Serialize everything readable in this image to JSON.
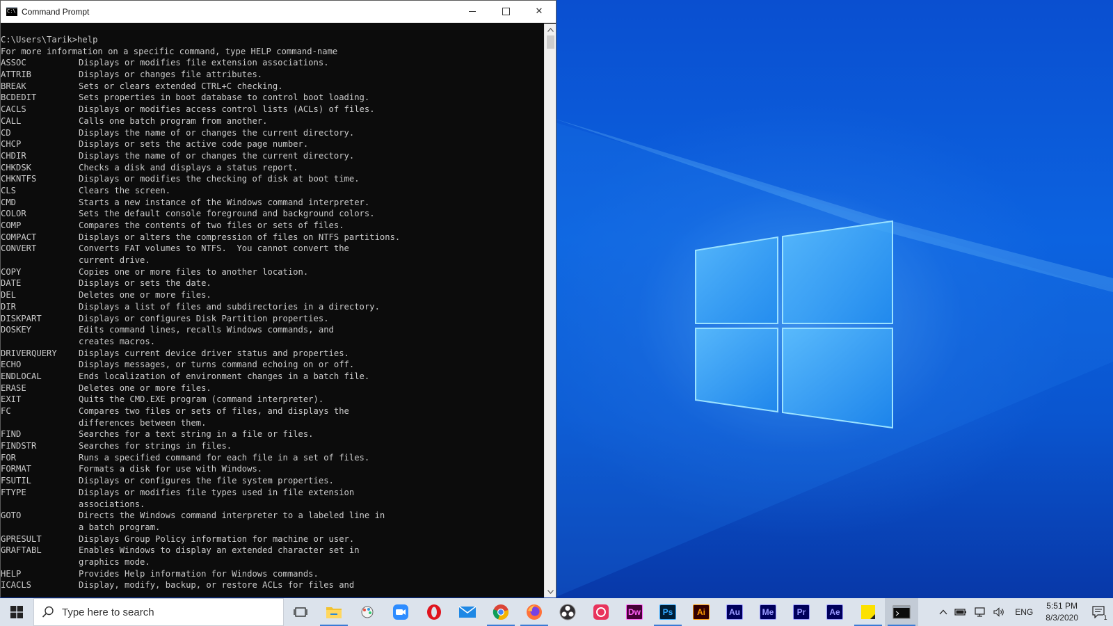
{
  "window": {
    "title": "Command Prompt",
    "close_glyph": "✕",
    "icon_text": "C:\\"
  },
  "console": {
    "prompt_line": "C:\\Users\\Tarik>help",
    "intro_line": "For more information on a specific command, type HELP command-name",
    "commands": [
      {
        "name": "ASSOC",
        "desc": "Displays or modifies file extension associations."
      },
      {
        "name": "ATTRIB",
        "desc": "Displays or changes file attributes."
      },
      {
        "name": "BREAK",
        "desc": "Sets or clears extended CTRL+C checking."
      },
      {
        "name": "BCDEDIT",
        "desc": "Sets properties in boot database to control boot loading."
      },
      {
        "name": "CACLS",
        "desc": "Displays or modifies access control lists (ACLs) of files."
      },
      {
        "name": "CALL",
        "desc": "Calls one batch program from another."
      },
      {
        "name": "CD",
        "desc": "Displays the name of or changes the current directory."
      },
      {
        "name": "CHCP",
        "desc": "Displays or sets the active code page number."
      },
      {
        "name": "CHDIR",
        "desc": "Displays the name of or changes the current directory."
      },
      {
        "name": "CHKDSK",
        "desc": "Checks a disk and displays a status report."
      },
      {
        "name": "CHKNTFS",
        "desc": "Displays or modifies the checking of disk at boot time."
      },
      {
        "name": "CLS",
        "desc": "Clears the screen."
      },
      {
        "name": "CMD",
        "desc": "Starts a new instance of the Windows command interpreter."
      },
      {
        "name": "COLOR",
        "desc": "Sets the default console foreground and background colors."
      },
      {
        "name": "COMP",
        "desc": "Compares the contents of two files or sets of files."
      },
      {
        "name": "COMPACT",
        "desc": "Displays or alters the compression of files on NTFS partitions."
      },
      {
        "name": "CONVERT",
        "desc": "Converts FAT volumes to NTFS.  You cannot convert the"
      },
      {
        "name": "",
        "desc": "current drive."
      },
      {
        "name": "COPY",
        "desc": "Copies one or more files to another location."
      },
      {
        "name": "DATE",
        "desc": "Displays or sets the date."
      },
      {
        "name": "DEL",
        "desc": "Deletes one or more files."
      },
      {
        "name": "DIR",
        "desc": "Displays a list of files and subdirectories in a directory."
      },
      {
        "name": "DISKPART",
        "desc": "Displays or configures Disk Partition properties."
      },
      {
        "name": "DOSKEY",
        "desc": "Edits command lines, recalls Windows commands, and"
      },
      {
        "name": "",
        "desc": "creates macros."
      },
      {
        "name": "DRIVERQUERY",
        "desc": "Displays current device driver status and properties."
      },
      {
        "name": "ECHO",
        "desc": "Displays messages, or turns command echoing on or off."
      },
      {
        "name": "ENDLOCAL",
        "desc": "Ends localization of environment changes in a batch file."
      },
      {
        "name": "ERASE",
        "desc": "Deletes one or more files."
      },
      {
        "name": "EXIT",
        "desc": "Quits the CMD.EXE program (command interpreter)."
      },
      {
        "name": "FC",
        "desc": "Compares two files or sets of files, and displays the"
      },
      {
        "name": "",
        "desc": "differences between them."
      },
      {
        "name": "FIND",
        "desc": "Searches for a text string in a file or files."
      },
      {
        "name": "FINDSTR",
        "desc": "Searches for strings in files."
      },
      {
        "name": "FOR",
        "desc": "Runs a specified command for each file in a set of files."
      },
      {
        "name": "FORMAT",
        "desc": "Formats a disk for use with Windows."
      },
      {
        "name": "FSUTIL",
        "desc": "Displays or configures the file system properties."
      },
      {
        "name": "FTYPE",
        "desc": "Displays or modifies file types used in file extension"
      },
      {
        "name": "",
        "desc": "associations."
      },
      {
        "name": "GOTO",
        "desc": "Directs the Windows command interpreter to a labeled line in"
      },
      {
        "name": "",
        "desc": "a batch program."
      },
      {
        "name": "GPRESULT",
        "desc": "Displays Group Policy information for machine or user."
      },
      {
        "name": "GRAFTABL",
        "desc": "Enables Windows to display an extended character set in"
      },
      {
        "name": "",
        "desc": "graphics mode."
      },
      {
        "name": "HELP",
        "desc": "Provides Help information for Windows commands."
      },
      {
        "name": "ICACLS",
        "desc": "Display, modify, backup, or restore ACLs for files and"
      }
    ]
  },
  "taskbar": {
    "search_placeholder": "Type here to search",
    "apps": [
      {
        "id": "task-view",
        "icon": "task-view-icon",
        "label": ""
      },
      {
        "id": "file-explorer",
        "icon": "folder-icon",
        "label": "",
        "color": "#f2c230"
      },
      {
        "id": "paint-3d",
        "icon": "paint-icon",
        "label": ""
      },
      {
        "id": "zoom",
        "icon": "video-camera-icon",
        "label": "",
        "color": "#2d8cff"
      },
      {
        "id": "opera",
        "icon": "opera-icon",
        "label": "",
        "color": "#e0141e"
      },
      {
        "id": "mail",
        "icon": "mail-icon",
        "label": "",
        "color": "#1e88e5"
      },
      {
        "id": "chrome",
        "icon": "chrome-icon",
        "label": ""
      },
      {
        "id": "firefox",
        "icon": "firefox-icon",
        "label": "",
        "color": "#ff7139"
      },
      {
        "id": "obs",
        "icon": "obs-icon",
        "label": ""
      },
      {
        "id": "creative-cloud",
        "icon": "creative-cloud-icon",
        "label": "",
        "color": "#e8335c"
      },
      {
        "id": "dreamweaver",
        "icon": "dreamweaver-icon",
        "label": "Dw",
        "bg": "#470137",
        "fg": "#ff61f6"
      },
      {
        "id": "photoshop",
        "icon": "photoshop-icon",
        "label": "Ps",
        "bg": "#001e36",
        "fg": "#31a8ff"
      },
      {
        "id": "illustrator",
        "icon": "illustrator-icon",
        "label": "Ai",
        "bg": "#330000",
        "fg": "#ff9a00"
      },
      {
        "id": "audition",
        "icon": "audition-icon",
        "label": "Au",
        "bg": "#00005b",
        "fg": "#9999ff"
      },
      {
        "id": "media-encoder",
        "icon": "media-encoder-icon",
        "label": "Me",
        "bg": "#00005b",
        "fg": "#9999ff"
      },
      {
        "id": "premiere",
        "icon": "premiere-icon",
        "label": "Pr",
        "bg": "#00005b",
        "fg": "#9999ff"
      },
      {
        "id": "after-effects",
        "icon": "after-effects-icon",
        "label": "Ae",
        "bg": "#00005b",
        "fg": "#9999ff"
      },
      {
        "id": "sticky-notes",
        "icon": "sticky-notes-icon",
        "label": "",
        "color": "#fce100"
      },
      {
        "id": "command-prompt",
        "icon": "terminal-icon",
        "label": ""
      }
    ]
  },
  "tray": {
    "language": "ENG",
    "time": "5:51 PM",
    "date": "8/3/2020",
    "notification_count": "1"
  }
}
